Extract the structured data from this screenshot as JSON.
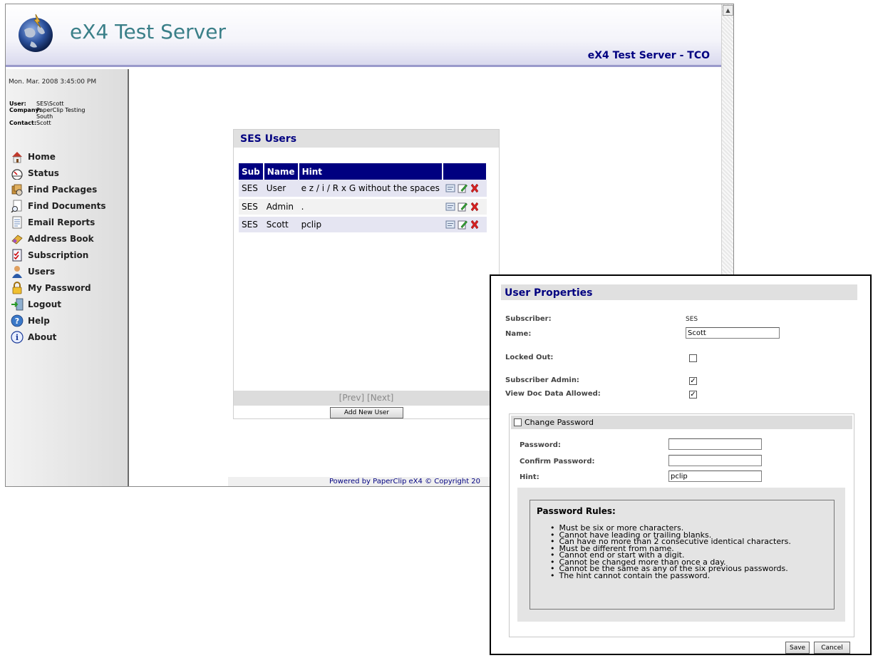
{
  "header": {
    "app_title": "eX4 Test Server",
    "server_subtitle": "eX4 Test Server - TCO"
  },
  "sidebar": {
    "datetime": "Mon. Mar. 2008 3:45:00 PM",
    "info": {
      "user_label": "User:",
      "user_value": "SES\\Scott",
      "company_label": "Company:",
      "company_value": "PaperClip Testing South",
      "contact_label": "Contact:",
      "contact_value": "Scott"
    },
    "nav": [
      {
        "label": "Home",
        "icon": "home-icon"
      },
      {
        "label": "Status",
        "icon": "gauge-icon"
      },
      {
        "label": "Find Packages",
        "icon": "packages-icon"
      },
      {
        "label": "Find Documents",
        "icon": "documents-icon"
      },
      {
        "label": "Email Reports",
        "icon": "report-icon"
      },
      {
        "label": "Address Book",
        "icon": "address-book-icon"
      },
      {
        "label": "Subscription",
        "icon": "subscription-icon"
      },
      {
        "label": "Users",
        "icon": "user-icon"
      },
      {
        "label": "My Password",
        "icon": "lock-icon"
      },
      {
        "label": "Logout",
        "icon": "logout-icon"
      },
      {
        "label": "Help",
        "icon": "help-icon"
      },
      {
        "label": "About",
        "icon": "info-icon"
      }
    ]
  },
  "users_panel": {
    "title": "SES Users",
    "columns": [
      "Sub",
      "Name",
      "Hint",
      ""
    ],
    "rows": [
      {
        "sub": "SES",
        "name": "User",
        "hint": "e z / i / R x G without the spaces"
      },
      {
        "sub": "SES",
        "name": "Admin",
        "hint": "."
      },
      {
        "sub": "SES",
        "name": "Scott",
        "hint": "pclip"
      }
    ],
    "pager": "[Prev] [Next]",
    "add_button": "Add New User"
  },
  "footer": {
    "text": "Powered by PaperClip eX4 © Copyright 20"
  },
  "user_properties": {
    "title": "User Properties",
    "subscriber_label": "Subscriber:",
    "subscriber_value": "SES",
    "name_label": "Name:",
    "name_value": "Scott",
    "locked_out_label": "Locked Out:",
    "locked_out": false,
    "subscriber_admin_label": "Subscriber Admin:",
    "subscriber_admin": true,
    "view_doc_label": "View Doc Data Allowed:",
    "view_doc": true,
    "change_password_label": "Change Password",
    "change_password": false,
    "password_label": "Password:",
    "password_value": "",
    "confirm_label": "Confirm Password:",
    "confirm_value": "",
    "hint_label": "Hint:",
    "hint_value": "pclip",
    "rules_title": "Password Rules:",
    "rules": [
      "Must be six or more characters.",
      "Cannot have leading or trailing blanks.",
      "Can have no more than 2 consecutive identical characters.",
      "Must be different from name.",
      "Cannot end or start with a digit.",
      "Cannot be changed more than once a day.",
      "Cannot be the same as any of the six previous passwords.",
      "The hint cannot contain the password."
    ],
    "save_label": "Save",
    "cancel_label": "Cancel"
  },
  "colors": {
    "accent_navy": "#000080",
    "title_teal": "#3a7f88",
    "delete_red": "#d62020"
  }
}
